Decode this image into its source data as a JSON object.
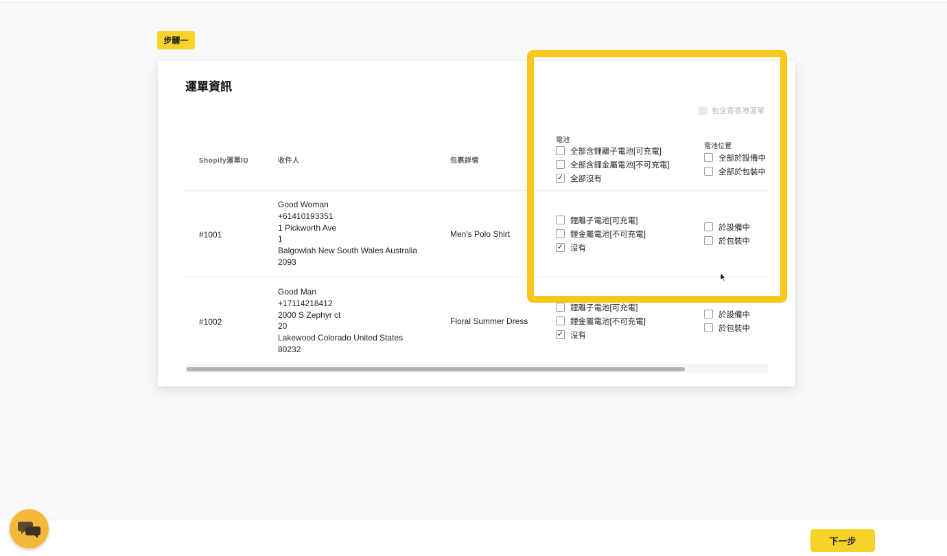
{
  "step": {
    "label": "步驟一"
  },
  "card": {
    "title": "運單資訊"
  },
  "hk_toggle": {
    "label": "包含寄香港運單"
  },
  "table": {
    "headers": {
      "id": "Shopify運單ID",
      "recipient": "收件人",
      "package": "包裹詳情"
    },
    "battery_header": {
      "label": "電池",
      "options": [
        "全部含鋰離子電池[可充電]",
        "全部含鋰金屬電池[不可充電]",
        "全部沒有"
      ]
    },
    "battery_position_header": {
      "label": "電池位置",
      "options": [
        "全部於設備中",
        "全部於包裝中"
      ]
    },
    "rows": [
      {
        "id": "#1001",
        "recipient": [
          "Good Woman",
          "+61410193351",
          "1 Pickworth Ave",
          "1",
          "Balgowlah  New South Wales  Australia",
          "2093"
        ],
        "package": "Men's Polo Shirt",
        "battery_options": [
          "鋰離子電池[可充電]",
          "鋰金屬電池[不可充電]",
          "沒有"
        ],
        "position_options": [
          "於設備中",
          "於包裝中"
        ]
      },
      {
        "id": "#1002",
        "recipient": [
          "Good Man",
          "+17114218412",
          "2000 S Zephyr ct",
          "20",
          "Lakewood  Colorado  United States",
          "80232"
        ],
        "package": "Floral Summer Dress",
        "battery_options": [
          "鋰離子電池[可充電]",
          "鋰金屬電池[不可充電]",
          "沒有"
        ],
        "position_options": [
          "於設備中",
          "於包裝中"
        ]
      }
    ]
  },
  "check_mark": "✓",
  "footer": {
    "next_label": "下一步"
  },
  "colors": {
    "accent": "#f7d22a",
    "highlight": "#f8c71c",
    "chat": "#f5b93a"
  },
  "icons": {
    "chat": "chat-bubbles-icon"
  }
}
